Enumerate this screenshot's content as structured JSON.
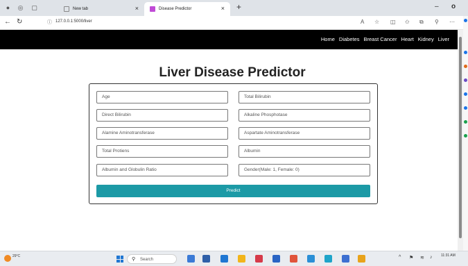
{
  "browser": {
    "tabs": [
      {
        "label": "New tab",
        "active": false
      },
      {
        "label": "Disease Predictor",
        "active": true
      }
    ],
    "new_tab_symbol": "+",
    "url": "127.0.0.1:5000/liver",
    "minimize_symbol": "–",
    "close_symbol": "✕"
  },
  "navbar": {
    "links": [
      "Home",
      "Diabetes",
      "Breast Cancer",
      "Heart",
      "Kidney",
      "Liver"
    ]
  },
  "page": {
    "title": "Liver Disease Predictor"
  },
  "form": {
    "fields": [
      {
        "placeholder": "Age"
      },
      {
        "placeholder": "Total Bilirubin"
      },
      {
        "placeholder": "Direct Bilirubin"
      },
      {
        "placeholder": "Alkaline Phosphotase"
      },
      {
        "placeholder": "Alamine Aminotransferase"
      },
      {
        "placeholder": "Aspartate Aminotransferase"
      },
      {
        "placeholder": "Total Protiens"
      },
      {
        "placeholder": "Albumin"
      },
      {
        "placeholder": "Albumin and Globulin Ratio"
      },
      {
        "placeholder": "Gender(Male: 1, Female: 0)"
      }
    ],
    "submit_label": "Predict"
  },
  "taskbar": {
    "weather_temp": "29°C",
    "search_placeholder": "Search",
    "clock_time": "11:31 AM"
  },
  "colors": {
    "navbar_bg": "#000000",
    "button_bg": "#1c9aa6",
    "tab_strip_bg": "#dfe3e8"
  }
}
